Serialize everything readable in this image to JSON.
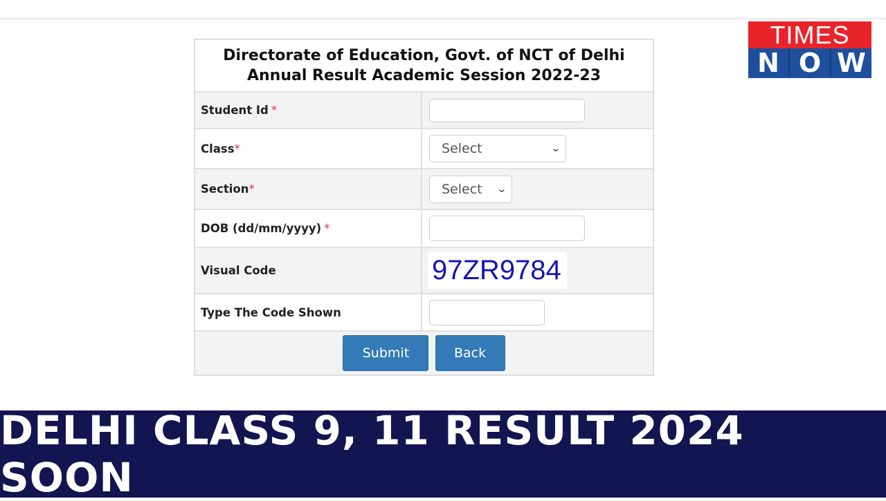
{
  "logo": {
    "top": "TIMES",
    "bottom": [
      "N",
      "O",
      "W"
    ],
    "red": "#e8232a",
    "blue": "#1d4f9c"
  },
  "form": {
    "title_line1": "Directorate of Education, Govt. of NCT of Delhi",
    "title_line2": "Annual Result Academic Session 2022-23",
    "fields": {
      "student_id": {
        "label": "Student Id",
        "required": "*",
        "value": ""
      },
      "class": {
        "label": "Class",
        "required": "*",
        "selected": "Select"
      },
      "section": {
        "label": "Section",
        "required": "*",
        "selected": "Select"
      },
      "dob": {
        "label": "DOB (dd/mm/yyyy)",
        "required": "*",
        "value": ""
      },
      "visual_code": {
        "label": "Visual Code",
        "code": "97ZR9784"
      },
      "code_input": {
        "label": "Type The Code Shown",
        "value": ""
      }
    },
    "buttons": {
      "submit": "Submit",
      "back": "Back"
    },
    "accent": "#337ab7"
  },
  "banner": {
    "text": "DELHI CLASS 9, 11 RESULT 2024 SOON",
    "background": "#131550"
  }
}
